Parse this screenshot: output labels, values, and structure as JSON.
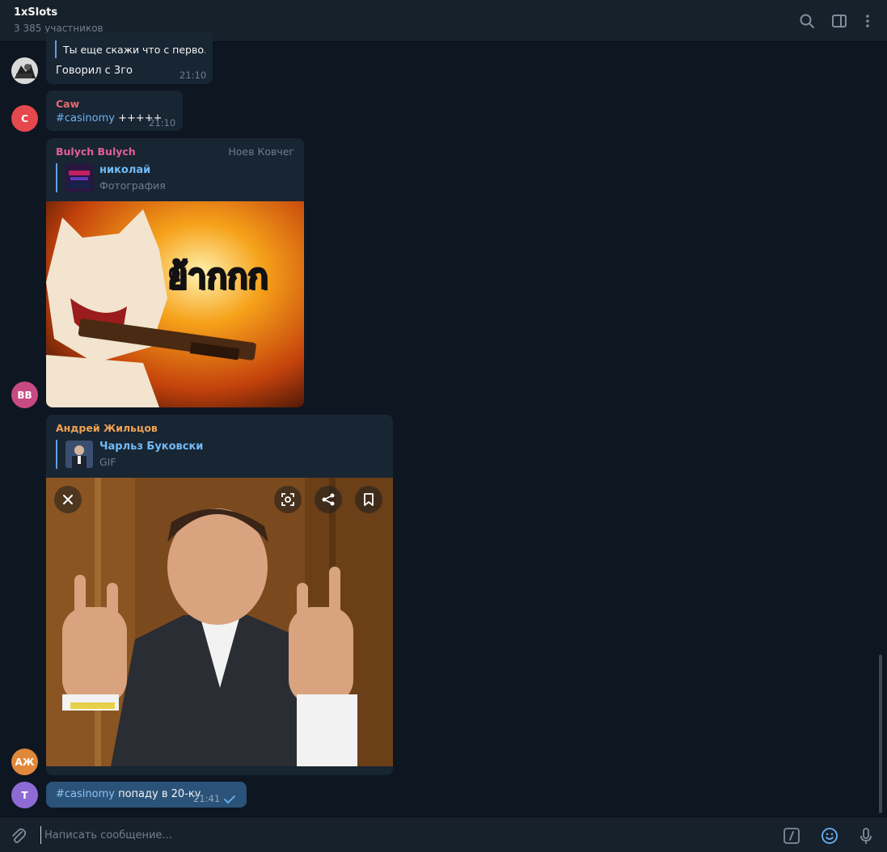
{
  "header": {
    "title": "1xSlots",
    "subtitle": "3 385 участников",
    "icons": [
      "search-icon",
      "sidebar-toggle-icon",
      "more-vertical-icon"
    ]
  },
  "messages": [
    {
      "avatar_icon": "user-photo-avatar",
      "reply_text": "Ты еще скажи что с перво...",
      "text": "Говорил с 3го",
      "time": "21:10"
    },
    {
      "avatar_initials": "C",
      "avatar_color": "#e5484d",
      "sender": "Caw",
      "sender_color": "#e86a6a",
      "hashtag": "#casinomy",
      "text": " +++++",
      "time": "21:10"
    },
    {
      "avatar_initials": "BB",
      "avatar_color": "#c74a82",
      "sender": "Bulych Bulych",
      "sender_color": "#e25f98",
      "forward_from": "Ноев Ковчег",
      "reply_title": "николай",
      "reply_text": "Фотография",
      "media_caption_in_image": "ย้ากกก",
      "media_icon": "cat-with-gun-photo"
    },
    {
      "avatar_initials": "АЖ",
      "avatar_color": "#e0883a",
      "sender": "Андрей Жильцов",
      "sender_color": "#f0a155",
      "reply_title": "Чарльз Буковски",
      "reply_text": "GIF",
      "media_icon": "man-rock-gesture-gif",
      "media_buttons": [
        "close-icon",
        "scan-icon",
        "share-icon",
        "bookmark-icon"
      ]
    },
    {
      "avatar_initials": "T",
      "avatar_color": "#8e6bd4",
      "hashtag": "#casinomy",
      "text": " попаду в 20-ку",
      "time": "21:41",
      "status_icon": "check-icon",
      "outgoing_color": "#2b5278"
    }
  ],
  "composer": {
    "placeholder": "Написать сообщение...",
    "icons": [
      "attach-icon",
      "commands-icon",
      "emoji-icon",
      "microphone-icon"
    ]
  }
}
